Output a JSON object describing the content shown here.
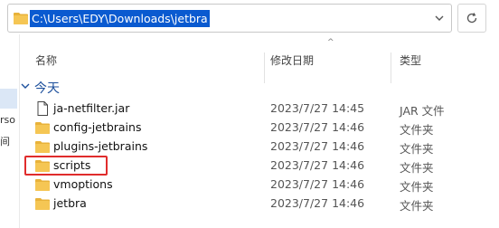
{
  "address_bar": {
    "path": "C:\\Users\\EDY\\Downloads\\jetbra"
  },
  "nav_fragments": [
    "rso",
    "间"
  ],
  "columns": {
    "name": "名称",
    "date": "修改日期",
    "type": "类型"
  },
  "group": {
    "label": "今天"
  },
  "files": [
    {
      "name": "ja-netfilter.jar",
      "date": "2023/7/27 14:45",
      "type": "JAR 文件",
      "icon": "file-icon"
    },
    {
      "name": "config-jetbrains",
      "date": "2023/7/27 14:46",
      "type": "文件夹",
      "icon": "folder-icon"
    },
    {
      "name": "plugins-jetbrains",
      "date": "2023/7/27 14:46",
      "type": "文件夹",
      "icon": "folder-icon"
    },
    {
      "name": "scripts",
      "date": "2023/7/27 14:46",
      "type": "文件夹",
      "icon": "folder-icon"
    },
    {
      "name": "vmoptions",
      "date": "2023/7/27 14:46",
      "type": "文件夹",
      "icon": "folder-icon"
    },
    {
      "name": "jetbra",
      "date": "2023/7/27 14:46",
      "type": "文件夹",
      "icon": "folder-icon"
    }
  ],
  "colors": {
    "selection": "#0a5ad0",
    "highlight_box": "#e02c2c",
    "folder": "#e8b23a",
    "group_label": "#1c4f9c"
  }
}
